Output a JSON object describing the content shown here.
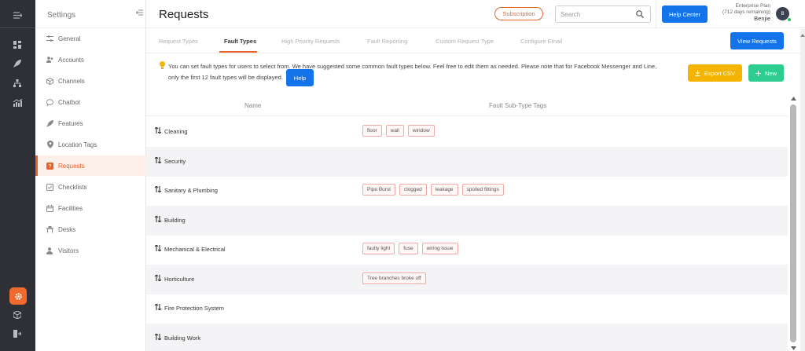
{
  "app": {
    "title": "Requests",
    "subscription_label": "Subscription",
    "help_center_label": "Help Center",
    "search": {
      "placeholder": "Search",
      "value": ""
    },
    "plan": {
      "line1": "Enterprise Plan",
      "line2": "(712 days remaining)",
      "user": "Benjie"
    },
    "avatar_initial": "B"
  },
  "sidebar": {
    "title": "Settings",
    "items": [
      {
        "label": "General",
        "icon": "sliders-icon"
      },
      {
        "label": "Accounts",
        "icon": "users-icon"
      },
      {
        "label": "Channels",
        "icon": "cube-icon"
      },
      {
        "label": "Chatbot",
        "icon": "chat-icon"
      },
      {
        "label": "Features",
        "icon": "rocket-icon"
      },
      {
        "label": "Location Tags",
        "icon": "pin-icon"
      },
      {
        "label": "Requests",
        "icon": "request-icon"
      },
      {
        "label": "Checklists",
        "icon": "checklist-icon"
      },
      {
        "label": "Facilities",
        "icon": "calendar-icon"
      },
      {
        "label": "Desks",
        "icon": "desk-icon"
      },
      {
        "label": "Visitors",
        "icon": "visitor-icon"
      }
    ],
    "active": "Requests"
  },
  "tabs": [
    {
      "label": "Request Types"
    },
    {
      "label": "Fault Types"
    },
    {
      "label": "High Priority Requests"
    },
    {
      "label": "Fault Reporting"
    },
    {
      "label": "Custom Request Type"
    },
    {
      "label": "Configure Email"
    }
  ],
  "active_tab": "Fault Types",
  "view_requests_label": "View Requests",
  "info": {
    "line1": "You can set fault types for users to select from. We have suggested some common fault types below. Feel free to edit them as needed. Please note that for Facebook Messenger and Line,",
    "line2": "only the first 12 fault types will be displayed.",
    "help_label": "Help"
  },
  "actions": {
    "export_label": "Export CSV",
    "new_label": "New"
  },
  "table": {
    "headers": {
      "name": "Name",
      "tags": "Fault Sub-Type Tags"
    },
    "rows": [
      {
        "name": "Cleaning",
        "tags": [
          "floor",
          "wall",
          "window"
        ]
      },
      {
        "name": "Security",
        "tags": []
      },
      {
        "name": "Sanitary & Plumbing",
        "tags": [
          "Pipe Burst",
          "clogged",
          "leakage",
          "spoiled fittings"
        ]
      },
      {
        "name": "Building",
        "tags": []
      },
      {
        "name": "Mechanical & Electrical",
        "tags": [
          "faulty light",
          "fuse",
          "wiring issue"
        ]
      },
      {
        "name": "Horticulture",
        "tags": [
          "Tree branches broke off"
        ]
      },
      {
        "name": "Fire Protection System",
        "tags": []
      },
      {
        "name": "Building Work",
        "tags": []
      }
    ]
  },
  "colors": {
    "accent": "#e8622d",
    "primary": "#1273eb",
    "warning": "#f5b400",
    "success": "#2ecc8f",
    "rail": "#2e3035"
  }
}
